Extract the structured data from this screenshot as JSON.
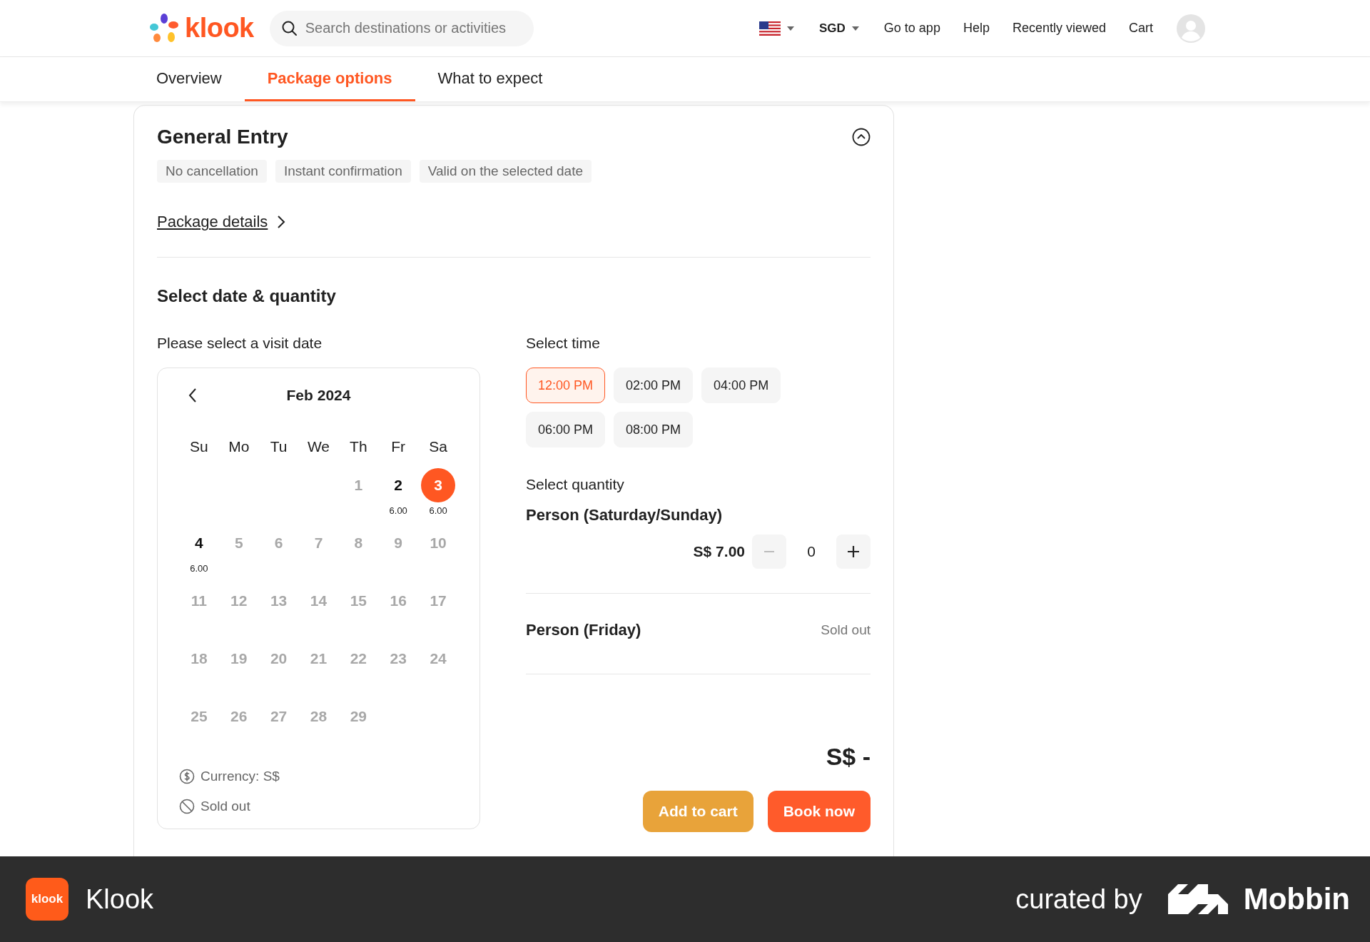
{
  "header": {
    "logo_text": "klook",
    "search": {
      "placeholder": "Search destinations or activities"
    },
    "currency": "SGD",
    "links": [
      "Go to app",
      "Help",
      "Recently viewed",
      "Cart"
    ]
  },
  "tabs": [
    {
      "label": "Overview",
      "selected": false
    },
    {
      "label": "Package options",
      "selected": true
    },
    {
      "label": "What to expect",
      "selected": false
    }
  ],
  "package": {
    "title": "General Entry",
    "expanded": true,
    "tags": [
      "No cancellation",
      "Instant confirmation",
      "Valid on the selected date"
    ],
    "details_link": "Package details",
    "section_title": "Select date & quantity",
    "date_label": "Please select a visit date",
    "calendar": {
      "month": "Feb 2024",
      "weekdays": [
        "Su",
        "Mo",
        "Tu",
        "We",
        "Th",
        "Fr",
        "Sa"
      ],
      "weeks": [
        [
          {
            "day": "1",
            "available": false,
            "selected": false
          },
          {
            "day": "2",
            "available": true,
            "selected": false,
            "price": "6.00"
          },
          {
            "day": "3",
            "available": true,
            "selected": true,
            "price": "6.00"
          }
        ],
        [
          {
            "day": "4",
            "available": true,
            "selected": false,
            "price": "6.00"
          },
          {
            "day": "5",
            "available": false,
            "selected": false
          },
          {
            "day": "6",
            "available": false,
            "selected": false
          },
          {
            "day": "7",
            "available": false,
            "selected": false
          },
          {
            "day": "8",
            "available": false,
            "selected": false
          },
          {
            "day": "9",
            "available": false,
            "selected": false
          },
          {
            "day": "10",
            "available": false,
            "selected": false
          }
        ],
        [
          {
            "day": "11",
            "available": false,
            "selected": false
          },
          {
            "day": "12",
            "available": false,
            "selected": false
          },
          {
            "day": "13",
            "available": false,
            "selected": false
          },
          {
            "day": "14",
            "available": false,
            "selected": false
          },
          {
            "day": "15",
            "available": false,
            "selected": false
          },
          {
            "day": "16",
            "available": false,
            "selected": false
          },
          {
            "day": "17",
            "available": false,
            "selected": false
          }
        ],
        [
          {
            "day": "18",
            "available": false,
            "selected": false
          },
          {
            "day": "19",
            "available": false,
            "selected": false
          },
          {
            "day": "20",
            "available": false,
            "selected": false
          },
          {
            "day": "21",
            "available": false,
            "selected": false
          },
          {
            "day": "22",
            "available": false,
            "selected": false
          },
          {
            "day": "23",
            "available": false,
            "selected": false
          },
          {
            "day": "24",
            "available": false,
            "selected": false
          }
        ],
        [
          {
            "day": "25",
            "available": false,
            "selected": false
          },
          {
            "day": "26",
            "available": false,
            "selected": false
          },
          {
            "day": "27",
            "available": false,
            "selected": false
          },
          {
            "day": "28",
            "available": false,
            "selected": false
          },
          {
            "day": "29",
            "available": false,
            "selected": false
          }
        ]
      ],
      "legend": [
        {
          "kind": "currency",
          "text": "Currency: S$"
        },
        {
          "kind": "sold_out",
          "text": "Sold out"
        }
      ]
    },
    "time_label": "Select time",
    "times": [
      {
        "label": "12:00 PM",
        "selected": true
      },
      {
        "label": "02:00 PM",
        "selected": false
      },
      {
        "label": "04:00 PM",
        "selected": false
      },
      {
        "label": "06:00 PM",
        "selected": false
      },
      {
        "label": "08:00 PM",
        "selected": false
      }
    ],
    "quantity_label": "Select quantity",
    "quantity_items": [
      {
        "kind": "counter",
        "name": "Person (Saturday/Sunday)",
        "price": "S$ 7.00",
        "count": "0",
        "minus_disabled": true
      },
      {
        "kind": "sold_out",
        "name": "Person (Friday)",
        "status": "Sold out"
      }
    ],
    "total": "S$ -",
    "buttons": [
      {
        "kind": "cart",
        "label": "Add to cart"
      },
      {
        "kind": "book",
        "label": "Book now"
      }
    ]
  },
  "footer_bar": {
    "app_icon_text": "klook",
    "app_name": "Klook",
    "curated": "curated by",
    "brand": "Mobbin"
  }
}
